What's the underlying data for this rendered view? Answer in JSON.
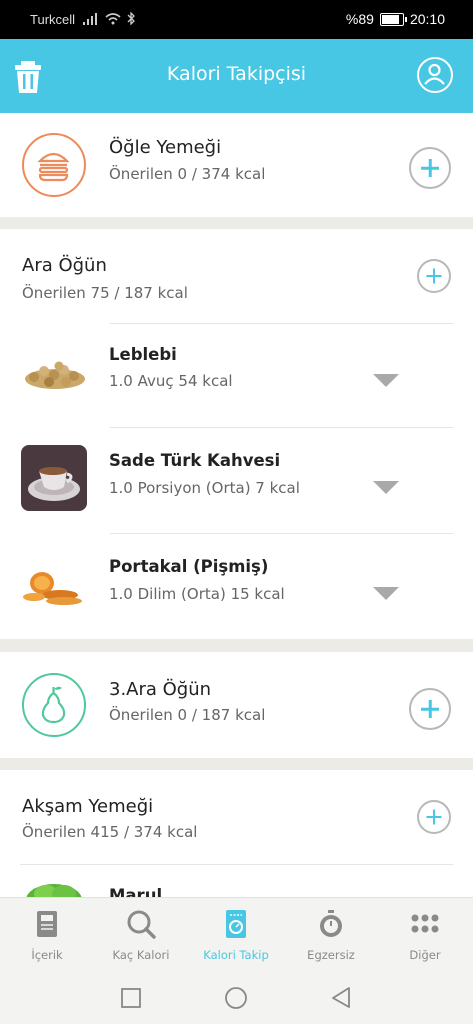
{
  "status": {
    "carrier": "Turkcell",
    "battery": "%89",
    "time": "20:10"
  },
  "header": {
    "title": "Kalori Takipçisi"
  },
  "meals": {
    "ogle": {
      "title": "Öğle Yemeği",
      "sub": "Önerilen 0 / 374 kcal"
    },
    "ara": {
      "title": "Ara Öğün",
      "sub": "Önerilen 75 / 187 kcal"
    },
    "ara3": {
      "title": "3.Ara Öğün",
      "sub": "Önerilen 0 / 187 kcal"
    },
    "aksam": {
      "title": "Akşam Yemeği",
      "sub": "Önerilen 415 / 374 kcal"
    }
  },
  "foods": [
    {
      "name": "Leblebi",
      "detail": "1.0 Avuç 54 kcal"
    },
    {
      "name": "Sade Türk Kahvesi",
      "detail": "1.0 Porsiyon (Orta) 7 kcal"
    },
    {
      "name": "Portakal (Pişmiş)",
      "detail": "1.0 Dilim (Orta) 15 kcal"
    },
    {
      "name": "Marul",
      "detail": ""
    }
  ],
  "nav": [
    {
      "label": "İçerik",
      "icon": "book-icon"
    },
    {
      "label": "Kaç Kalori",
      "icon": "search-icon"
    },
    {
      "label": "Kalori Takip",
      "icon": "scale-icon"
    },
    {
      "label": "Egzersiz",
      "icon": "stopwatch-icon"
    },
    {
      "label": "Diğer",
      "icon": "more-dots-icon"
    }
  ],
  "colors": {
    "accent": "#47c7e3",
    "orange": "#ef8a5a",
    "green": "#4fc99a"
  }
}
